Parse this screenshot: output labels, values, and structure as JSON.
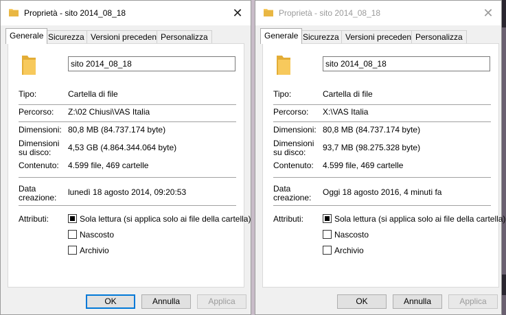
{
  "windows": [
    {
      "title": "Proprietà - sito 2014_08_18",
      "close_glyph": "✕",
      "tabs": [
        "Generale",
        "Sicurezza",
        "Versioni precedenti",
        "Personalizza"
      ],
      "folder_name": "sito 2014_08_18",
      "type_label": "Tipo:",
      "type_value": "Cartella di file",
      "path_label": "Percorso:",
      "path_value": "Z:\\02 Chiusi\\VAS Italia",
      "size_label": "Dimensioni:",
      "size_value": "80,8 MB (84.737.174 byte)",
      "disk_label_1": "Dimensioni",
      "disk_label_2": "su disco:",
      "disk_value": "4,53 GB (4.864.344.064 byte)",
      "content_label": "Contenuto:",
      "content_value": "4.599 file, 469 cartelle",
      "created_label_1": "Data",
      "created_label_2": "creazione:",
      "created_value": "lunedì 18 agosto 2014, 09:20:53",
      "attr_label": "Attributi:",
      "attributes": [
        {
          "label": "Sola lettura (si applica solo ai file della cartella)",
          "checked": true
        },
        {
          "label": "Nascosto",
          "checked": false
        },
        {
          "label": "Archivio",
          "checked": false
        }
      ],
      "buttons": {
        "ok": "OK",
        "cancel": "Annulla",
        "apply": "Applica"
      }
    },
    {
      "title": "Proprietà - sito 2014_08_18",
      "close_glyph": "✕",
      "tabs": [
        "Generale",
        "Sicurezza",
        "Versioni precedenti",
        "Personalizza"
      ],
      "folder_name": "sito 2014_08_18",
      "type_label": "Tipo:",
      "type_value": "Cartella di file",
      "path_label": "Percorso:",
      "path_value": "X:\\VAS Italia",
      "size_label": "Dimensioni:",
      "size_value": "80,8 MB (84.737.174 byte)",
      "disk_label_1": "Dimensioni",
      "disk_label_2": "su disco:",
      "disk_value": "93,7 MB (98.275.328 byte)",
      "content_label": "Contenuto:",
      "content_value": "4.599 file, 469 cartelle",
      "created_label_1": "Data",
      "created_label_2": "creazione:",
      "created_value": "Oggi 18 agosto 2016, 4 minuti fa",
      "attr_label": "Attributi:",
      "attributes": [
        {
          "label": "Sola lettura (si applica solo ai file della cartella)",
          "checked": true
        },
        {
          "label": "Nascosto",
          "checked": false
        },
        {
          "label": "Archivio",
          "checked": false
        }
      ],
      "buttons": {
        "ok": "OK",
        "cancel": "Annulla",
        "apply": "Applica"
      }
    }
  ],
  "colors": {
    "folder": "#f7c95c",
    "folder_dark": "#e3ad36",
    "accent": "#0078d7"
  }
}
